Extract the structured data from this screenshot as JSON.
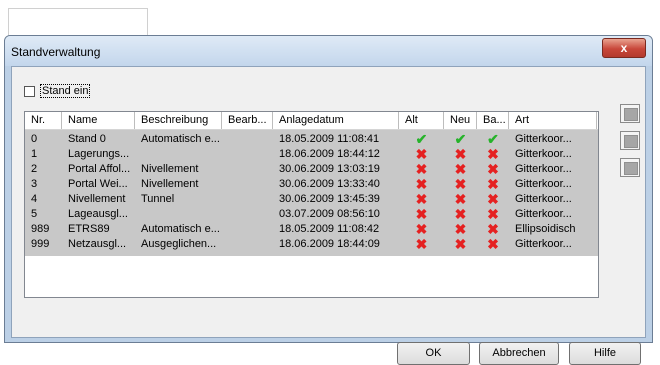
{
  "dialog": {
    "title": "Standverwaltung",
    "close_glyph": "x"
  },
  "checkbox": {
    "label": "Stand ein",
    "checked": false
  },
  "columns": [
    "Nr.",
    "Name",
    "Beschreibung",
    "Bearb...",
    "Anlagedatum",
    "Alt",
    "Neu",
    "Ba...",
    "Art"
  ],
  "rows": [
    {
      "nr": "0",
      "name": "Stand 0",
      "beschreibung": "Automatisch e...",
      "bearb": "",
      "datum": "18.05.2009 11:08:41",
      "alt": "check",
      "neu": "check",
      "ba": "check",
      "art": "Gitterkoor..."
    },
    {
      "nr": "1",
      "name": "Lagerungs...",
      "beschreibung": "",
      "bearb": "",
      "datum": "18.06.2009 18:44:12",
      "alt": "x",
      "neu": "x",
      "ba": "x",
      "art": "Gitterkoor..."
    },
    {
      "nr": "2",
      "name": "Portal Affol...",
      "beschreibung": "Nivellement",
      "bearb": "",
      "datum": "30.06.2009 13:03:19",
      "alt": "x",
      "neu": "x",
      "ba": "x",
      "art": "Gitterkoor..."
    },
    {
      "nr": "3",
      "name": "Portal Wei...",
      "beschreibung": "Nivellement",
      "bearb": "",
      "datum": "30.06.2009 13:33:40",
      "alt": "x",
      "neu": "x",
      "ba": "x",
      "art": "Gitterkoor..."
    },
    {
      "nr": "4",
      "name": "Nivellement",
      "beschreibung": "Tunnel",
      "bearb": "",
      "datum": "30.06.2009 13:45:39",
      "alt": "x",
      "neu": "x",
      "ba": "x",
      "art": "Gitterkoor..."
    },
    {
      "nr": "5",
      "name": "Lageausgl...",
      "beschreibung": "",
      "bearb": "",
      "datum": "03.07.2009 08:56:10",
      "alt": "x",
      "neu": "x",
      "ba": "x",
      "art": "Gitterkoor..."
    },
    {
      "nr": "989",
      "name": "ETRS89",
      "beschreibung": "Automatisch e...",
      "bearb": "",
      "datum": "18.05.2009 11:08:42",
      "alt": "x",
      "neu": "x",
      "ba": "x",
      "art": "Ellipsoidisch"
    },
    {
      "nr": "999",
      "name": "Netzausgl...",
      "beschreibung": "Ausgeglichen...",
      "bearb": "",
      "datum": "18.06.2009 18:44:09",
      "alt": "x",
      "neu": "x",
      "ba": "x",
      "art": "Gitterkoor..."
    }
  ],
  "buttons": {
    "ok": "OK",
    "cancel": "Abbrechen",
    "help": "Hilfe"
  },
  "colors": {
    "check": "#26b32a",
    "cross": "#e52121",
    "row_bg": "#c8c8c8"
  }
}
